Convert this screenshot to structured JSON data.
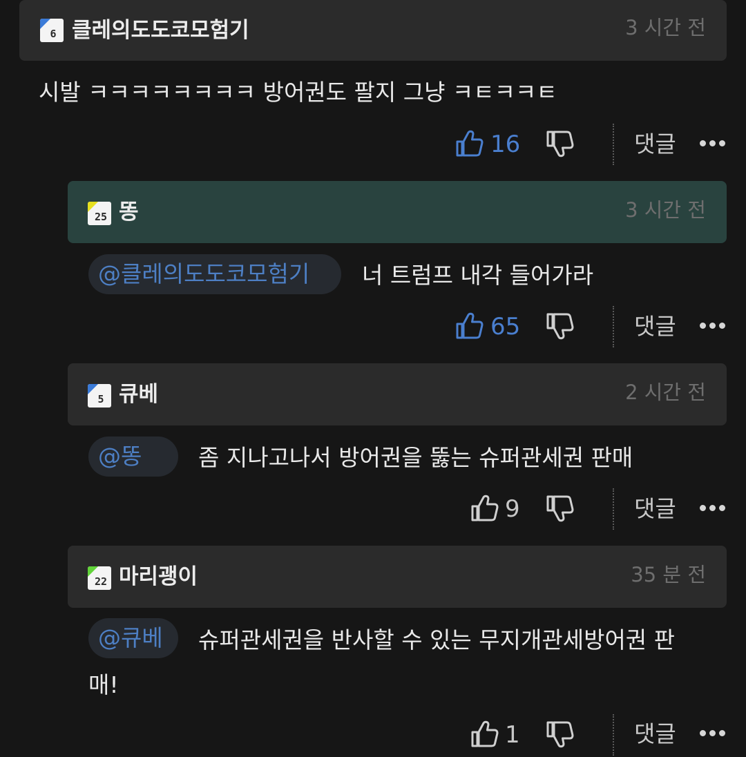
{
  "comments": [
    {
      "username": "클레의도도코모험기",
      "badge_level": "6",
      "badge_color": "#3b7bd8",
      "time": "3 시간 전",
      "mention": "",
      "text": "시발 ㅋㅋㅋㅋㅋㅋㅋㅋ 방어권도 팔지 그냥 ㅋㅌㅋㅋㅌ",
      "likes": "16",
      "liked": true,
      "reply_label": "댓글"
    },
    {
      "username": "똥",
      "badge_level": "25",
      "badge_color": "#e6e020",
      "time": "3 시간 전",
      "mention": "@클레의도도코모험기",
      "text": "너 트럼프 내각 들어가라",
      "likes": "65",
      "liked": true,
      "reply_label": "댓글"
    },
    {
      "username": "큐베",
      "badge_level": "5",
      "badge_color": "#3b7bd8",
      "time": "2 시간 전",
      "mention": "@똥",
      "text": "좀 지나고나서 방어권을 뚫는 슈퍼관세권 판매",
      "likes": "9",
      "liked": false,
      "reply_label": "댓글"
    },
    {
      "username": "마리괭이",
      "badge_level": "22",
      "badge_color": "#62d43a",
      "time": "35 분 전",
      "mention": "@큐베",
      "text_line1": "슈퍼관세권을 반사할 수 있는 무지개관세방어권 판",
      "text_line2": "매!",
      "likes": "1",
      "liked": false,
      "reply_label": "댓글"
    }
  ],
  "colors": {
    "background": "#161616",
    "header": "#2b2b2b",
    "header_highlight": "#29433f",
    "mention": "#4d7fc4",
    "liked": "#4a7fcf"
  }
}
